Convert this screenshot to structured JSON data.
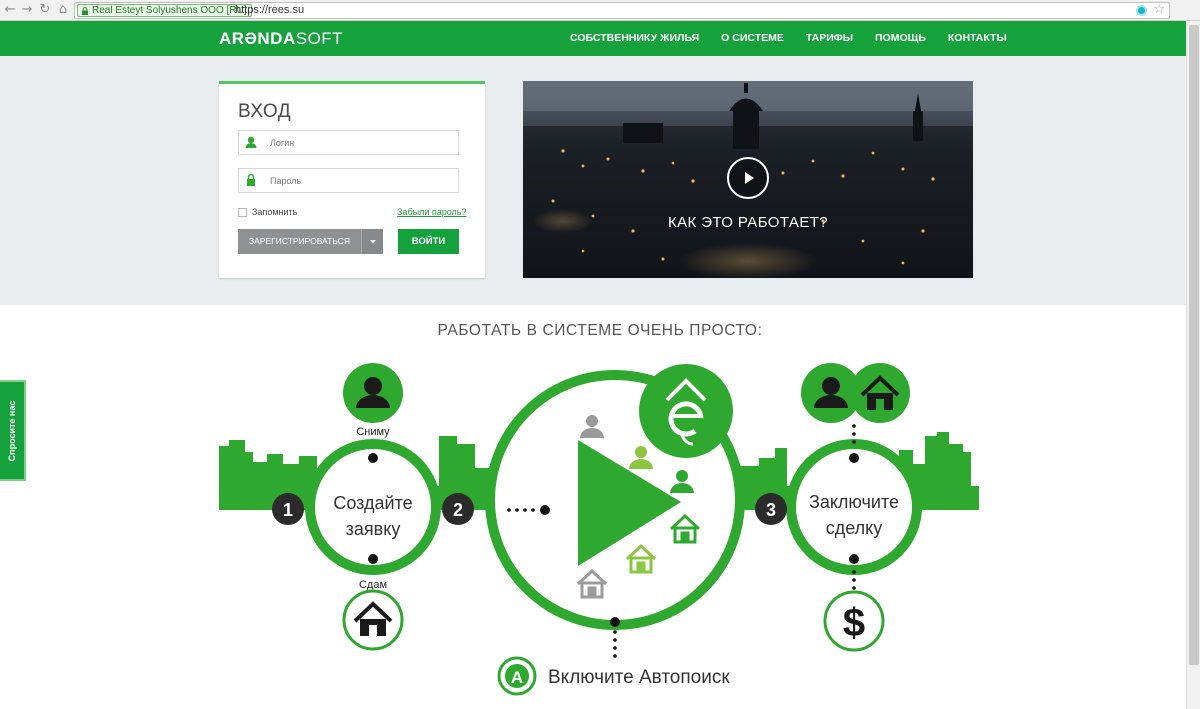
{
  "browser": {
    "ev_label": "Real Esteyt Solyushens OOO [RU]",
    "url": "https://rees.su"
  },
  "header": {
    "logo_bold": "ARƏNDA",
    "logo_light": "SOFT",
    "menu": [
      {
        "label": "СОБСТВЕННИКУ ЖИЛЬЯ"
      },
      {
        "label": "О СИСТЕМЕ"
      },
      {
        "label": "ТАРИФЫ"
      },
      {
        "label": "ПОМОЩЬ"
      },
      {
        "label": "КОНТАКТЫ"
      }
    ]
  },
  "login": {
    "title": "ВХОД",
    "login_placeholder": "Логин",
    "password_placeholder": "Пароль",
    "remember_label": "Запомнить",
    "forgot_label": "Забыли пароль?",
    "register_label": "ЗАРЕГИСТРИРОВАТЬСЯ",
    "login_button": "ВОЙТИ"
  },
  "video": {
    "caption": "КАК ЭТО РАБОТАЕТ?"
  },
  "feedback": {
    "label": "Спросите нас"
  },
  "section": {
    "title": "РАБОТАТЬ В СИСТЕМЕ ОЧЕНЬ ПРОСТО:"
  },
  "steps": {
    "step1_number": "1",
    "step1_line1": "Создайте",
    "step1_line2": "заявку",
    "rent_label": "Сниму",
    "lease_label": "Сдам",
    "step2_number": "2",
    "step3_number": "3",
    "step3_line1": "Заключите",
    "step3_line2": "сделку",
    "autosearch_letter": "A",
    "autosearch_label": "Включите Автопоиск",
    "dollar": "$"
  },
  "colors": {
    "brand_green": "#15a13c",
    "bright_green": "#2fa82f",
    "light_green": "#8cc63f",
    "grey": "#9a9a9a"
  }
}
